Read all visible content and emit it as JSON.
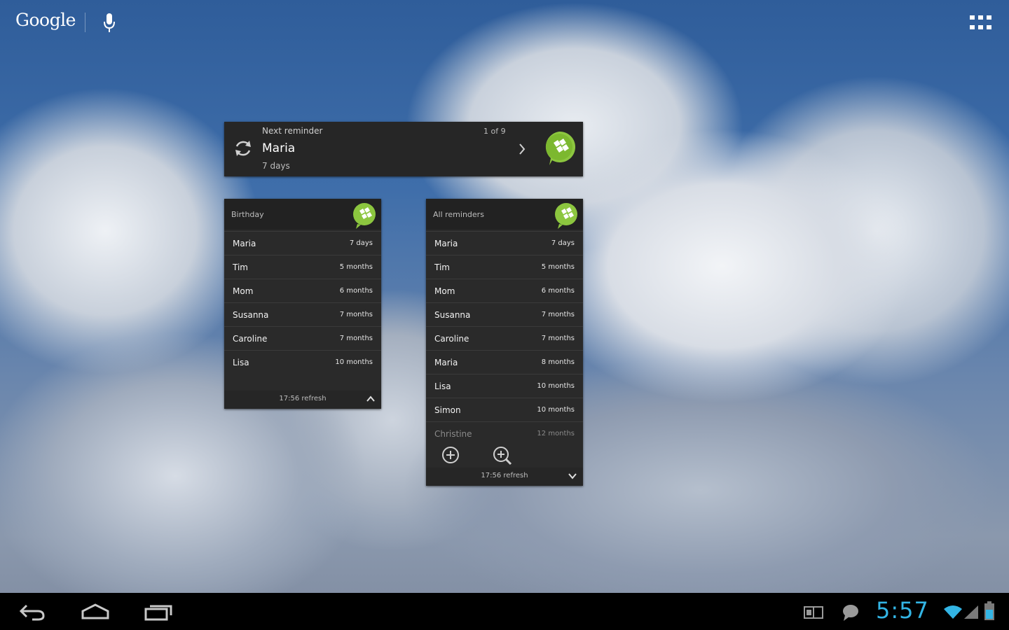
{
  "topbar": {
    "logo": "Google",
    "mic_icon": "microphone-icon",
    "apps_icon": "apps-grid-icon"
  },
  "next_reminder": {
    "label": "Next reminder",
    "name": "Maria",
    "days": "7 days",
    "count": "1 of 9"
  },
  "birthday": {
    "title": "Birthday",
    "rows": [
      {
        "name": "Maria",
        "when": "7 days"
      },
      {
        "name": "Tim",
        "when": "5 months"
      },
      {
        "name": "Mom",
        "when": "6 months"
      },
      {
        "name": "Susanna",
        "when": "7 months"
      },
      {
        "name": "Caroline",
        "when": "7 months"
      },
      {
        "name": "Lisa",
        "when": "10 months"
      }
    ],
    "footer": "17:56 refresh"
  },
  "all": {
    "title": "All reminders",
    "rows": [
      {
        "name": "Maria",
        "when": "7 days"
      },
      {
        "name": "Tim",
        "when": "5 months"
      },
      {
        "name": "Mom",
        "when": "6 months"
      },
      {
        "name": "Susanna",
        "when": "7 months"
      },
      {
        "name": "Caroline",
        "when": "7 months"
      },
      {
        "name": "Maria",
        "when": "8 months"
      },
      {
        "name": "Lisa",
        "when": "10 months"
      },
      {
        "name": "Simon",
        "when": "10 months"
      },
      {
        "name": "Christine",
        "when": "12 months"
      }
    ],
    "footer": "17:56 refresh"
  },
  "statusbar": {
    "time": "5:57"
  },
  "colors": {
    "accent": "#33b5e5",
    "brand_green": "#8cc63f",
    "widget_bg": "#2a2a2a"
  }
}
